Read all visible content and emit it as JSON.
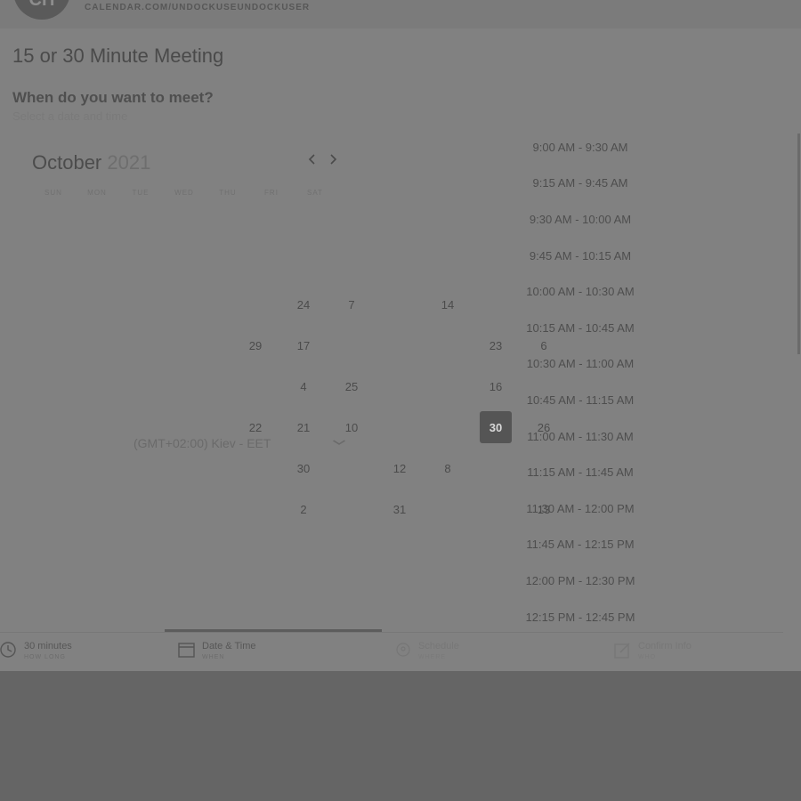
{
  "header": {
    "avatar_initials": "CH",
    "calendar_url": "CALENDAR.COM/UNDOCKUSEUNDOCKUSER"
  },
  "event": {
    "title": "15 or 30 Minute Meeting",
    "question": "When do you want to meet?",
    "hint": "Select a date and time"
  },
  "calendar": {
    "month": "October",
    "year": "2021",
    "prev_icon": "chevron-left-icon",
    "next_icon": "chevron-right-icon",
    "weekdays": [
      "SUN",
      "MON",
      "TUE",
      "WED",
      "THU",
      "FRI",
      "SAT"
    ],
    "days": [
      {
        "label": "24"
      },
      {
        "label": "7"
      },
      {
        "label": "14"
      },
      {
        "label": "6"
      },
      {
        "label": "29"
      },
      {
        "label": "17"
      },
      {
        "label": "23"
      },
      {
        "label": "4"
      },
      {
        "label": "25"
      },
      {
        "label": "16"
      },
      {
        "label": "22"
      },
      {
        "label": "21"
      },
      {
        "label": "10"
      },
      {
        "label": "30",
        "selected": true
      },
      {
        "label": "26"
      },
      {
        "label": "30"
      },
      {
        "label": "12"
      },
      {
        "label": "8"
      },
      {
        "label": "2"
      },
      {
        "label": "31"
      },
      {
        "label": "13"
      }
    ]
  },
  "timezone": {
    "label": "(GMT+02:00) Kiev - EET",
    "icon": "chevron-down-icon"
  },
  "time_slots": [
    "9:00 AM - 9:30 AM",
    "9:15 AM - 9:45 AM",
    "9:30 AM - 10:00 AM",
    "9:45 AM - 10:15 AM",
    "10:00 AM - 10:30 AM",
    "10:15 AM - 10:45 AM",
    "10:30 AM - 11:00 AM",
    "10:45 AM - 11:15 AM",
    "11:00 AM - 11:30 AM",
    "11:15 AM - 11:45 AM",
    "11:30 AM - 12:00 PM",
    "11:45 AM - 12:15 PM",
    "12:00 PM - 12:30 PM",
    "12:15 PM - 12:45 PM"
  ],
  "steps": [
    {
      "label": "30 minutes",
      "sub": "HOW LONG",
      "icon": "clock-icon",
      "state": "done"
    },
    {
      "label": "Date & Time",
      "sub": "WHEN",
      "icon": "calendar-icon",
      "state": "active"
    },
    {
      "label": "Schedule",
      "sub": "WHERE",
      "icon": "location-icon",
      "state": "pending"
    },
    {
      "label": "Confirm Info",
      "sub": "WHO",
      "icon": "edit-icon",
      "state": "pending"
    }
  ]
}
